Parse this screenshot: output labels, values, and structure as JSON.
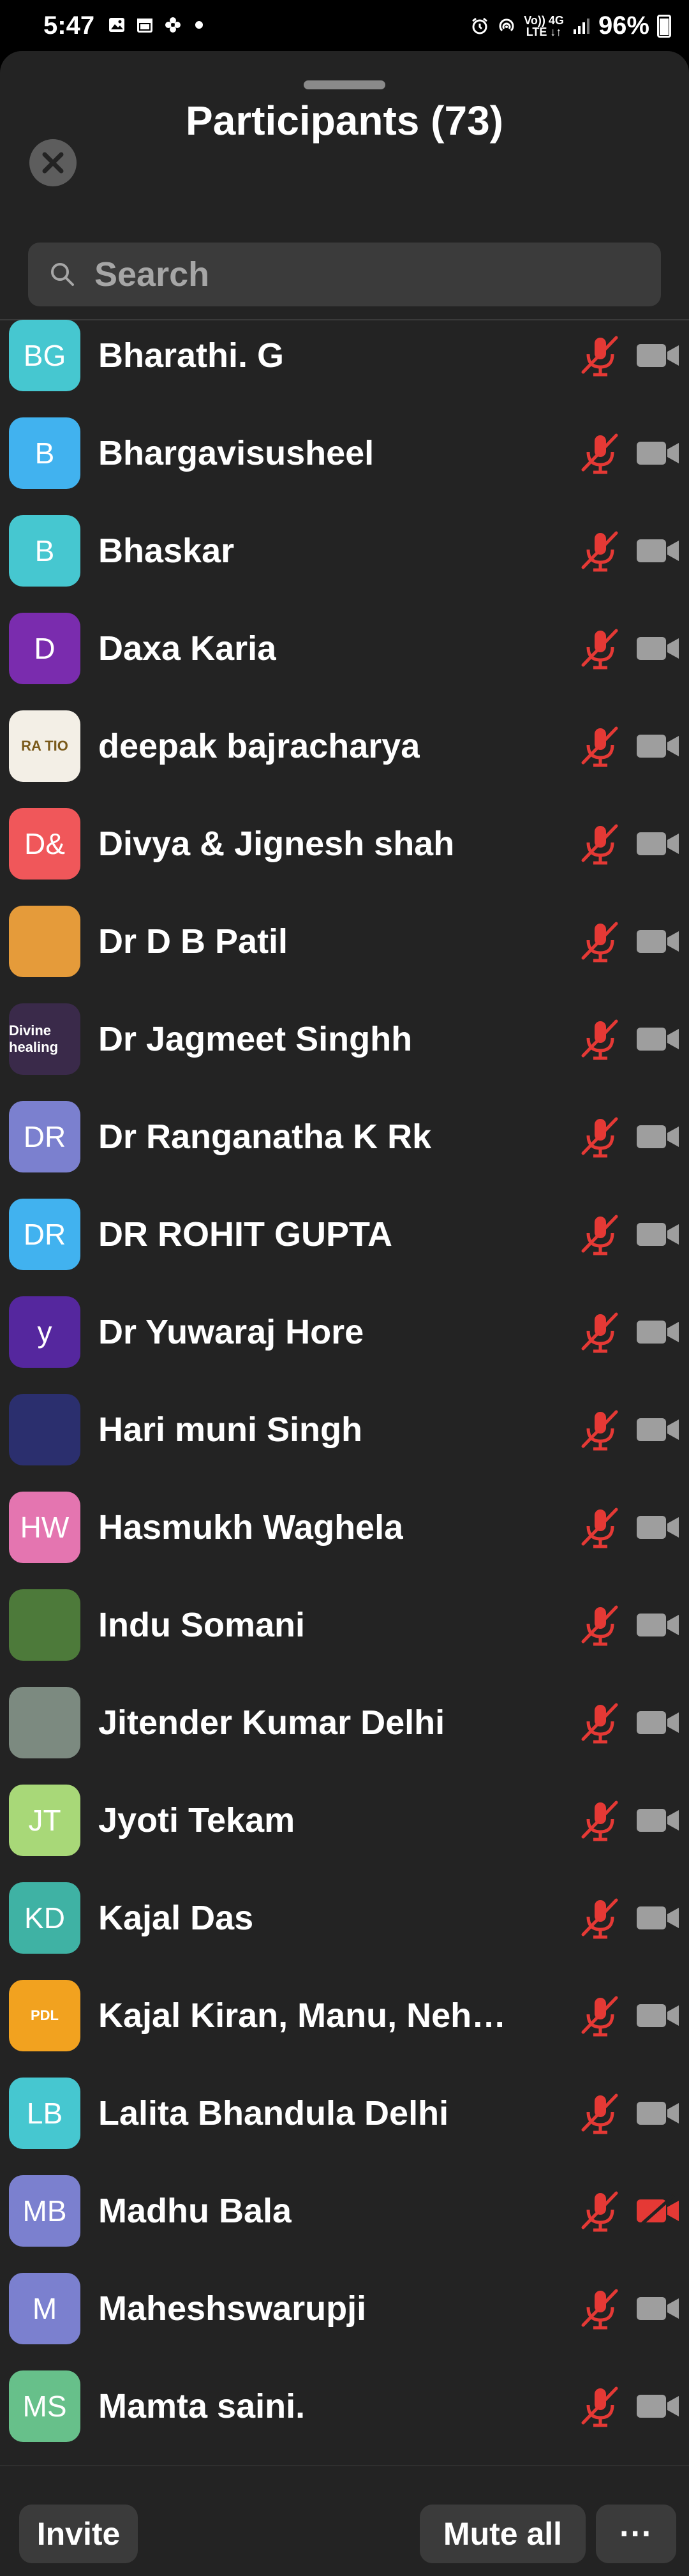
{
  "status_bar": {
    "time": "5:47",
    "battery": "96%",
    "network_top": "Vo)) 4G",
    "network_bottom": "LTE ↓↑"
  },
  "sheet": {
    "title": "Participants (73)"
  },
  "search": {
    "placeholder": "Search"
  },
  "colors": {
    "muted_red": "#e53935",
    "camera_gray": "#9e9e9e"
  },
  "participants": [
    {
      "initials": "BG",
      "name": "Bharathi. G",
      "avatar_color": "#46c7d0",
      "camera_off_red": false
    },
    {
      "initials": "B",
      "name": "Bhargavisusheel",
      "avatar_color": "#41b2ef",
      "camera_off_red": false
    },
    {
      "initials": "B",
      "name": "Bhaskar",
      "avatar_color": "#46c7d0",
      "camera_off_red": false
    },
    {
      "initials": "D",
      "name": "Daxa Karia",
      "avatar_color": "#7a2cae",
      "camera_off_red": false
    },
    {
      "initials": "RA TIO",
      "name": "deepak bajracharya",
      "avatar_color": "#f3efe6",
      "photo": true,
      "camera_off_red": false
    },
    {
      "initials": "D&",
      "name": "Divya & Jignesh shah",
      "avatar_color": "#f0575a",
      "camera_off_red": false
    },
    {
      "initials": "",
      "name": "Dr D B Patil",
      "avatar_color": "#e59b3a",
      "photo": true,
      "camera_off_red": false
    },
    {
      "initials": "Divine healing",
      "name": "Dr Jagmeet Singhh",
      "avatar_color": "#3a2a4a",
      "photo": true,
      "camera_off_red": false
    },
    {
      "initials": "DR",
      "name": "Dr Ranganatha K Rk",
      "avatar_color": "#7b80cf",
      "camera_off_red": false
    },
    {
      "initials": "DR",
      "name": "DR ROHIT GUPTA",
      "avatar_color": "#41b2ef",
      "camera_off_red": false
    },
    {
      "initials": "y",
      "name": "Dr Yuwaraj Hore",
      "avatar_color": "#55279e",
      "camera_off_red": false
    },
    {
      "initials": "",
      "name": "Hari muni Singh",
      "avatar_color": "#2b2f6e",
      "photo": true,
      "camera_off_red": false
    },
    {
      "initials": "HW",
      "name": "Hasmukh Waghela",
      "avatar_color": "#e475b0",
      "camera_off_red": false
    },
    {
      "initials": "",
      "name": "Indu Somani",
      "avatar_color": "#4d7a3a",
      "photo": true,
      "camera_off_red": false
    },
    {
      "initials": "",
      "name": "Jitender Kumar Delhi",
      "avatar_color": "#7c8a80",
      "photo": true,
      "camera_off_red": false
    },
    {
      "initials": "JT",
      "name": "Jyoti Tekam",
      "avatar_color": "#a8d878",
      "camera_off_red": false
    },
    {
      "initials": "KD",
      "name": "Kajal Das",
      "avatar_color": "#3fb2a4",
      "camera_off_red": false
    },
    {
      "initials": "PDL",
      "name": "Kajal Kiran, Manu, Neha...",
      "avatar_color": "#f2a21f",
      "photo": true,
      "camera_off_red": false
    },
    {
      "initials": "LB",
      "name": "Lalita Bhandula Delhi",
      "avatar_color": "#46c7d0",
      "camera_off_red": false
    },
    {
      "initials": "MB",
      "name": "Madhu Bala",
      "avatar_color": "#7b80cf",
      "camera_off_red": true
    },
    {
      "initials": "M",
      "name": "Maheshswarupji",
      "avatar_color": "#7b80cf",
      "camera_off_red": false
    },
    {
      "initials": "MS",
      "name": "Mamta saini.",
      "avatar_color": "#67c08a",
      "camera_off_red": false
    }
  ],
  "bottom_bar": {
    "invite_label": "Invite",
    "mute_all_label": "Mute all",
    "more_label": "···"
  }
}
